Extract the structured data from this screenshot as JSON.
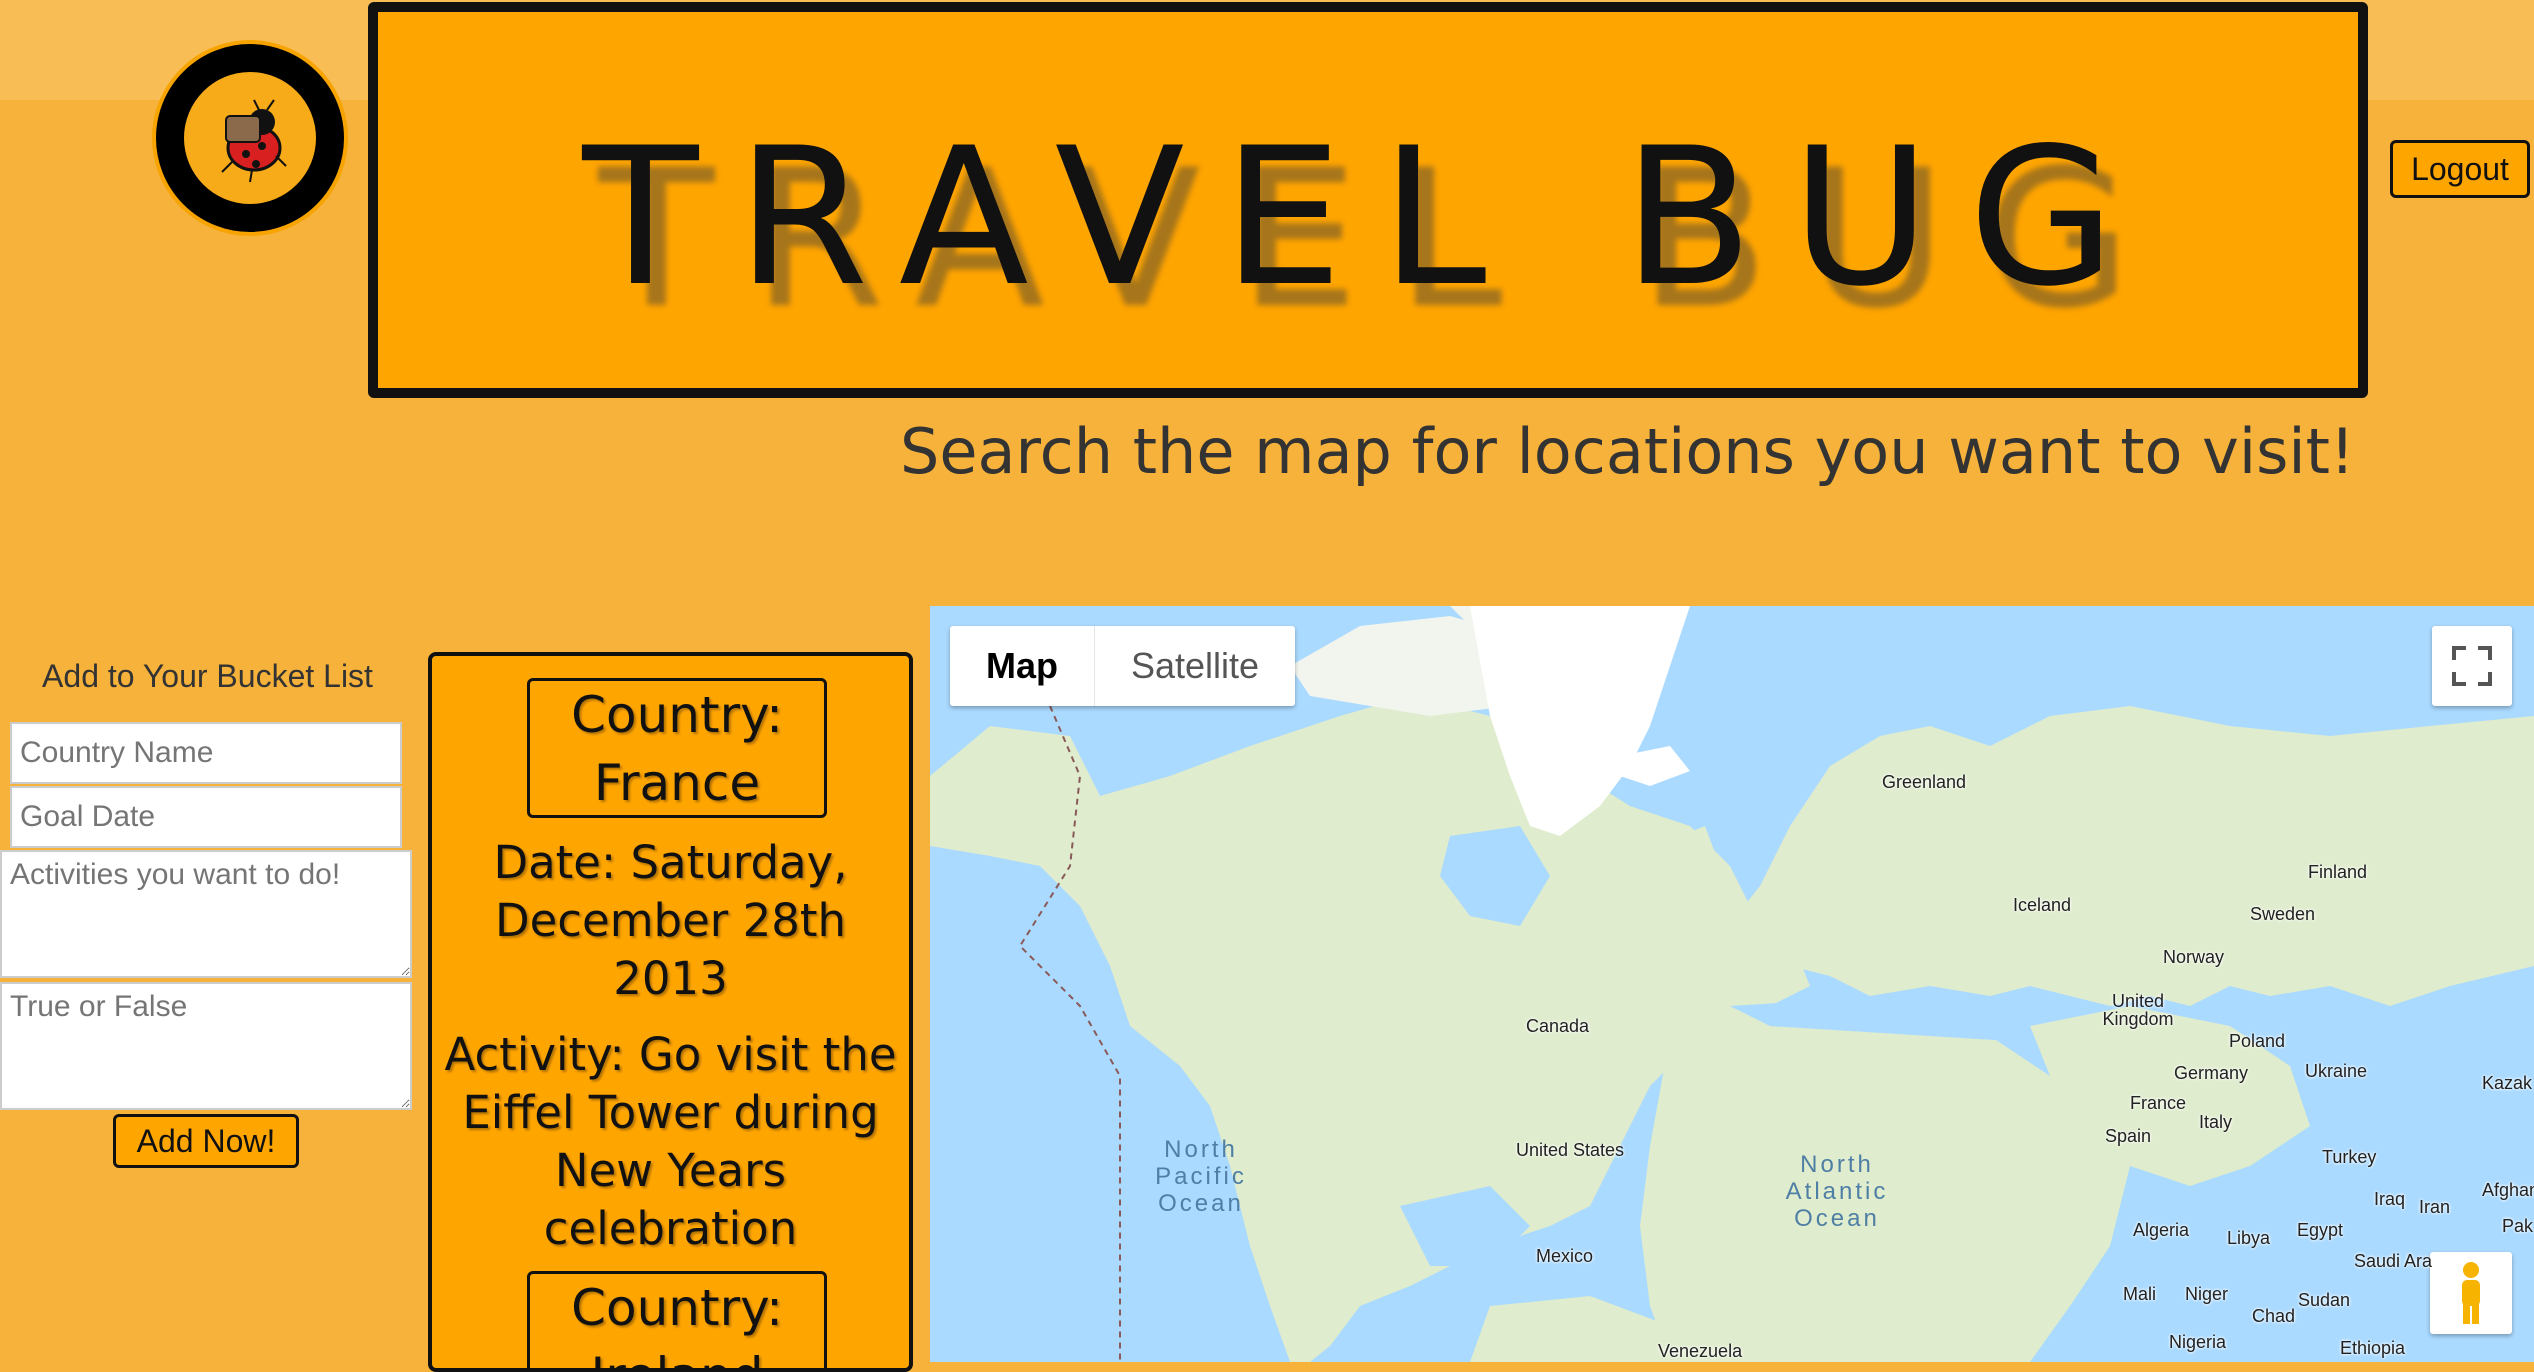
{
  "header": {
    "title": "TRAVEL BUG",
    "logout_label": "Logout",
    "subtitle": "Search the map for locations you want to visit!"
  },
  "form": {
    "title": "Add to Your Bucket List",
    "country_placeholder": "Country Name",
    "date_placeholder": "Goal Date",
    "activities_placeholder": "Activities you want to do!",
    "truefalse_placeholder": "True or False",
    "submit_label": "Add Now!"
  },
  "bucket_list": {
    "entries": [
      {
        "country": "Country:\nFrance",
        "date": "Date: Saturday, December 28th 2013",
        "activity": "Activity: Go visit the Eiffel Tower during New Years celebration"
      },
      {
        "country": "Country:\nIreland"
      }
    ]
  },
  "map": {
    "tabs": [
      "Map",
      "Satellite"
    ],
    "labels": [
      "Greenland",
      "Iceland",
      "Finland",
      "Sweden",
      "Norway",
      "United Kingdom",
      "Poland",
      "Germany",
      "Ukraine",
      "France",
      "Italy",
      "Spain",
      "Turkey",
      "Kazak",
      "Iraq",
      "Iran",
      "Afghan",
      "Pak",
      "Algeria",
      "Libya",
      "Egypt",
      "Saudi Ara",
      "Mali",
      "Niger",
      "Chad",
      "Sudan",
      "Nigeria",
      "Ethiopia",
      "Canada",
      "United States",
      "Mexico",
      "Venezuela"
    ],
    "oceans": [
      "North Pacific Ocean",
      "North Atlantic Ocean"
    ],
    "colors": {
      "water": "#aadaff",
      "land": "#dfeccd",
      "ice": "#ffffff"
    }
  }
}
